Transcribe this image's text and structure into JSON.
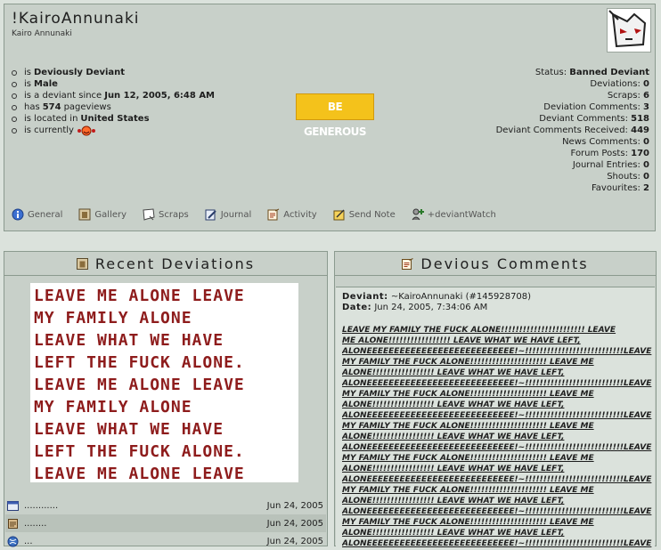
{
  "profile": {
    "title": "!KairoAnnunaki",
    "subtitle": "Kairo Annunaki",
    "info": [
      {
        "pre": "is",
        "bold": "Deviously Deviant",
        "post": ""
      },
      {
        "pre": "is",
        "bold": "Male",
        "post": ""
      },
      {
        "pre": "is a deviant since",
        "bold": "Jun 12, 2005, 6:48 AM",
        "post": ""
      },
      {
        "pre": "has",
        "bold": "574",
        "post": "pageviews"
      },
      {
        "pre": "is located in",
        "bold": "United States",
        "post": ""
      },
      {
        "pre": "is currently",
        "bold": "",
        "post": ""
      }
    ],
    "stats": [
      {
        "label": "Status:",
        "value": "Banned Deviant"
      },
      {
        "label": "Deviations:",
        "value": "0"
      },
      {
        "label": "Scraps:",
        "value": "6"
      },
      {
        "label": "Deviation Comments:",
        "value": "3"
      },
      {
        "label": "Deviant Comments:",
        "value": "518"
      },
      {
        "label": "Deviant Comments Received:",
        "value": "449"
      },
      {
        "label": "News Comments:",
        "value": "0"
      },
      {
        "label": "Forum Posts:",
        "value": "170"
      },
      {
        "label": "Journal Entries:",
        "value": "0"
      },
      {
        "label": "Shouts:",
        "value": "0"
      },
      {
        "label": "Favourites:",
        "value": "2"
      }
    ],
    "badge": "BE GENEROUS"
  },
  "tabs": [
    {
      "label": "General",
      "icon": "info-icon"
    },
    {
      "label": "Gallery",
      "icon": "gallery-icon"
    },
    {
      "label": "Scraps",
      "icon": "scraps-icon"
    },
    {
      "label": "Journal",
      "icon": "journal-icon"
    },
    {
      "label": "Activity",
      "icon": "activity-icon"
    },
    {
      "label": "Send Note",
      "icon": "note-icon"
    },
    {
      "label": "+deviantWatch",
      "icon": "watch-icon"
    }
  ],
  "recent": {
    "title": "Recent Deviations",
    "art_text": "LEAVE ME ALONE LEAVE\nMY FAMILY ALONE\nLEAVE WHAT WE HAVE\nLEFT THE FUCK ALONE.\nLEAVE ME ALONE LEAVE\nMY FAMILY ALONE\nLEAVE WHAT WE HAVE\nLEFT THE FUCK ALONE.\nLEAVE ME ALONE LEAVE",
    "items": [
      {
        "title": "............",
        "date": "Jun 24, 2005"
      },
      {
        "title": "........",
        "date": "Jun 24, 2005"
      },
      {
        "title": "...",
        "date": "Jun 24, 2005"
      }
    ]
  },
  "comments": {
    "title": "Devious Comments",
    "deviant_label": "Deviant:",
    "deviant_value": "~KairoAnnunaki (#145928708)",
    "date_label": "Date:",
    "date_value": "Jun 24, 2005, 7:34:06 AM",
    "body": "LEAVE MY FAMILY THE FUCK ALONE!!!!!!!!!!!!!!!!!!!!!!! LEAVE\nME ALONE!!!!!!!!!!!!!!!!! LEAVE WHAT WE HAVE LEFT,\nALONEEEEEEEEEEEEEEEEEEEEEEEEEEE!~!!!!!!!!!!!!!!!!!!!!!!!!!!!LEAVE\nMY FAMILY THE FUCK ALONE!!!!!!!!!!!!!!!!!!!!! LEAVE ME\nALONE!!!!!!!!!!!!!!!!! LEAVE WHAT WE HAVE LEFT,\nALONEEEEEEEEEEEEEEEEEEEEEEEEEEE!~!!!!!!!!!!!!!!!!!!!!!!!!!!!LEAVE\nMY FAMILY THE FUCK ALONE!!!!!!!!!!!!!!!!!!!!! LEAVE ME\nALONE!!!!!!!!!!!!!!!!! LEAVE WHAT WE HAVE LEFT,\nALONEEEEEEEEEEEEEEEEEEEEEEEEEEE!~!!!!!!!!!!!!!!!!!!!!!!!!!!!LEAVE\nMY FAMILY THE FUCK ALONE!!!!!!!!!!!!!!!!!!!!! LEAVE ME\nALONE!!!!!!!!!!!!!!!!! LEAVE WHAT WE HAVE LEFT,\nALONEEEEEEEEEEEEEEEEEEEEEEEEEEE!~!!!!!!!!!!!!!!!!!!!!!!!!!!!LEAVE\nMY FAMILY THE FUCK ALONE!!!!!!!!!!!!!!!!!!!!! LEAVE ME\nALONE!!!!!!!!!!!!!!!!! LEAVE WHAT WE HAVE LEFT,\nALONEEEEEEEEEEEEEEEEEEEEEEEEEEE!~!!!!!!!!!!!!!!!!!!!!!!!!!!!LEAVE\nMY FAMILY THE FUCK ALONE!!!!!!!!!!!!!!!!!!!!! LEAVE ME\nALONE!!!!!!!!!!!!!!!!! LEAVE WHAT WE HAVE LEFT,\nALONEEEEEEEEEEEEEEEEEEEEEEEEEEE!~!!!!!!!!!!!!!!!!!!!!!!!!!!!LEAVE\nMY FAMILY THE FUCK ALONE!!!!!!!!!!!!!!!!!!!!! LEAVE ME\nALONE!!!!!!!!!!!!!!!!! LEAVE WHAT WE HAVE LEFT,\nALONEEEEEEEEEEEEEEEEEEEEEEEEEEE!~!!!!!!!!!!!!!!!!!!!!!!!!!!!LEAVE"
  },
  "colors": {
    "accent": "#8e1c1c",
    "badge": "#f4c21b",
    "panel": "#c8d0c9"
  }
}
